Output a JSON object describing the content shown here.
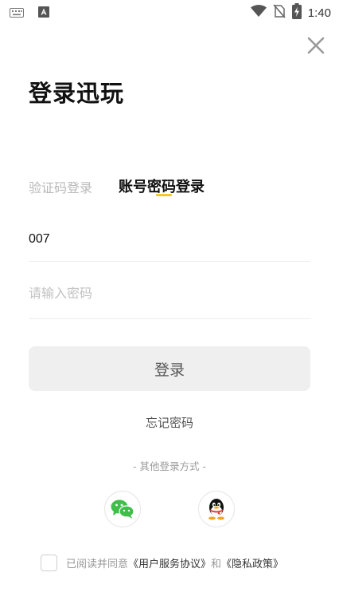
{
  "status_bar": {
    "time": "1:40",
    "icons": [
      "keyboard-icon",
      "app-notification-icon",
      "wifi-icon",
      "no-signal-icon",
      "battery-charging-icon"
    ]
  },
  "header": {
    "close_icon": "close-icon",
    "title": "登录迅玩"
  },
  "tabs": [
    {
      "label": "验证码登录",
      "active": false
    },
    {
      "label": "账号密码登录",
      "active": true
    }
  ],
  "form": {
    "account_value": "007",
    "password_placeholder": "请输入密码",
    "login_label": "登录",
    "forgot_label": "忘记密码"
  },
  "other_login": {
    "label": "- 其他登录方式 -",
    "providers": [
      {
        "name": "wechat",
        "icon": "wechat-icon"
      },
      {
        "name": "qq",
        "icon": "qq-icon"
      }
    ]
  },
  "agreement": {
    "checked": false,
    "prefix": "已阅读并同意",
    "user_agreement": "《用户服务协议》",
    "and": "和",
    "privacy_policy": "《隐私政策》"
  },
  "colors": {
    "accent": "#f6c729",
    "wechat": "#3fbf4a",
    "muted_text": "#999999",
    "button_bg": "#efefef"
  }
}
